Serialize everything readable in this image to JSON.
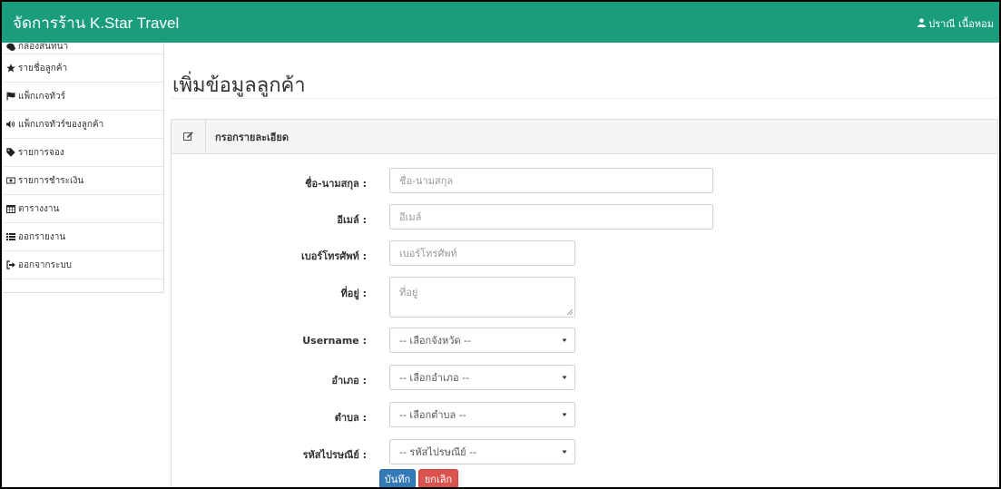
{
  "navbar": {
    "brand": "จัดการร้าน K.Star Travel",
    "user_name": "ปราณี เนื้อหอม",
    "color": "#199d7d"
  },
  "sidebar": {
    "items": [
      {
        "label": "กล่องสนทนา",
        "icon": "comments-icon"
      },
      {
        "label": "รายชื่อลูกค้า",
        "icon": "star-icon"
      },
      {
        "label": "แพ็กเกจทัวร์",
        "icon": "flag-icon"
      },
      {
        "label": "แพ็กเกจทัวร์ของลูกค้า",
        "icon": "volume-icon"
      },
      {
        "label": "รายการจอง",
        "icon": "tag-icon"
      },
      {
        "label": "รายการชำระเงิน",
        "icon": "money-icon"
      },
      {
        "label": "ตารางงาน",
        "icon": "calendar-icon"
      },
      {
        "label": "ออกรายงาน",
        "icon": "list-icon"
      },
      {
        "label": "ออกจากระบบ",
        "icon": "sign-out-icon"
      }
    ]
  },
  "main": {
    "title": "เพิ่มข้อมูลลูกค้า",
    "panel_heading": "กรอกรายละเอียด"
  },
  "form": {
    "name": {
      "label": "ชื่อ-นามสกุล :",
      "placeholder": "ชื่อ-นามสกุล"
    },
    "email": {
      "label": "อีเมล์ :",
      "placeholder": "อีเมล์"
    },
    "phone": {
      "label": "เบอร์โทรศัพท์ :",
      "placeholder": "เบอร์โทรศัพท์"
    },
    "address": {
      "label": "ที่อยู่ :",
      "placeholder": "ที่อยู่"
    },
    "username": {
      "label": "Username :",
      "selected": "-- เลือกจังหวัด --"
    },
    "district": {
      "label": "อำเภอ :",
      "selected": "-- เลือกอำเภอ --"
    },
    "subdistrict": {
      "label": "ตำบล :",
      "selected": "-- เลือกตำบล --"
    },
    "postcode": {
      "label": "รหัสไปรษณีย์ :",
      "selected": "-- รหัสไปรษณีย์ --"
    },
    "save_label": "บันทึก",
    "cancel_label": "ยกเลิก"
  },
  "colors": {
    "primary": "#337ab7",
    "danger": "#d9534f"
  }
}
